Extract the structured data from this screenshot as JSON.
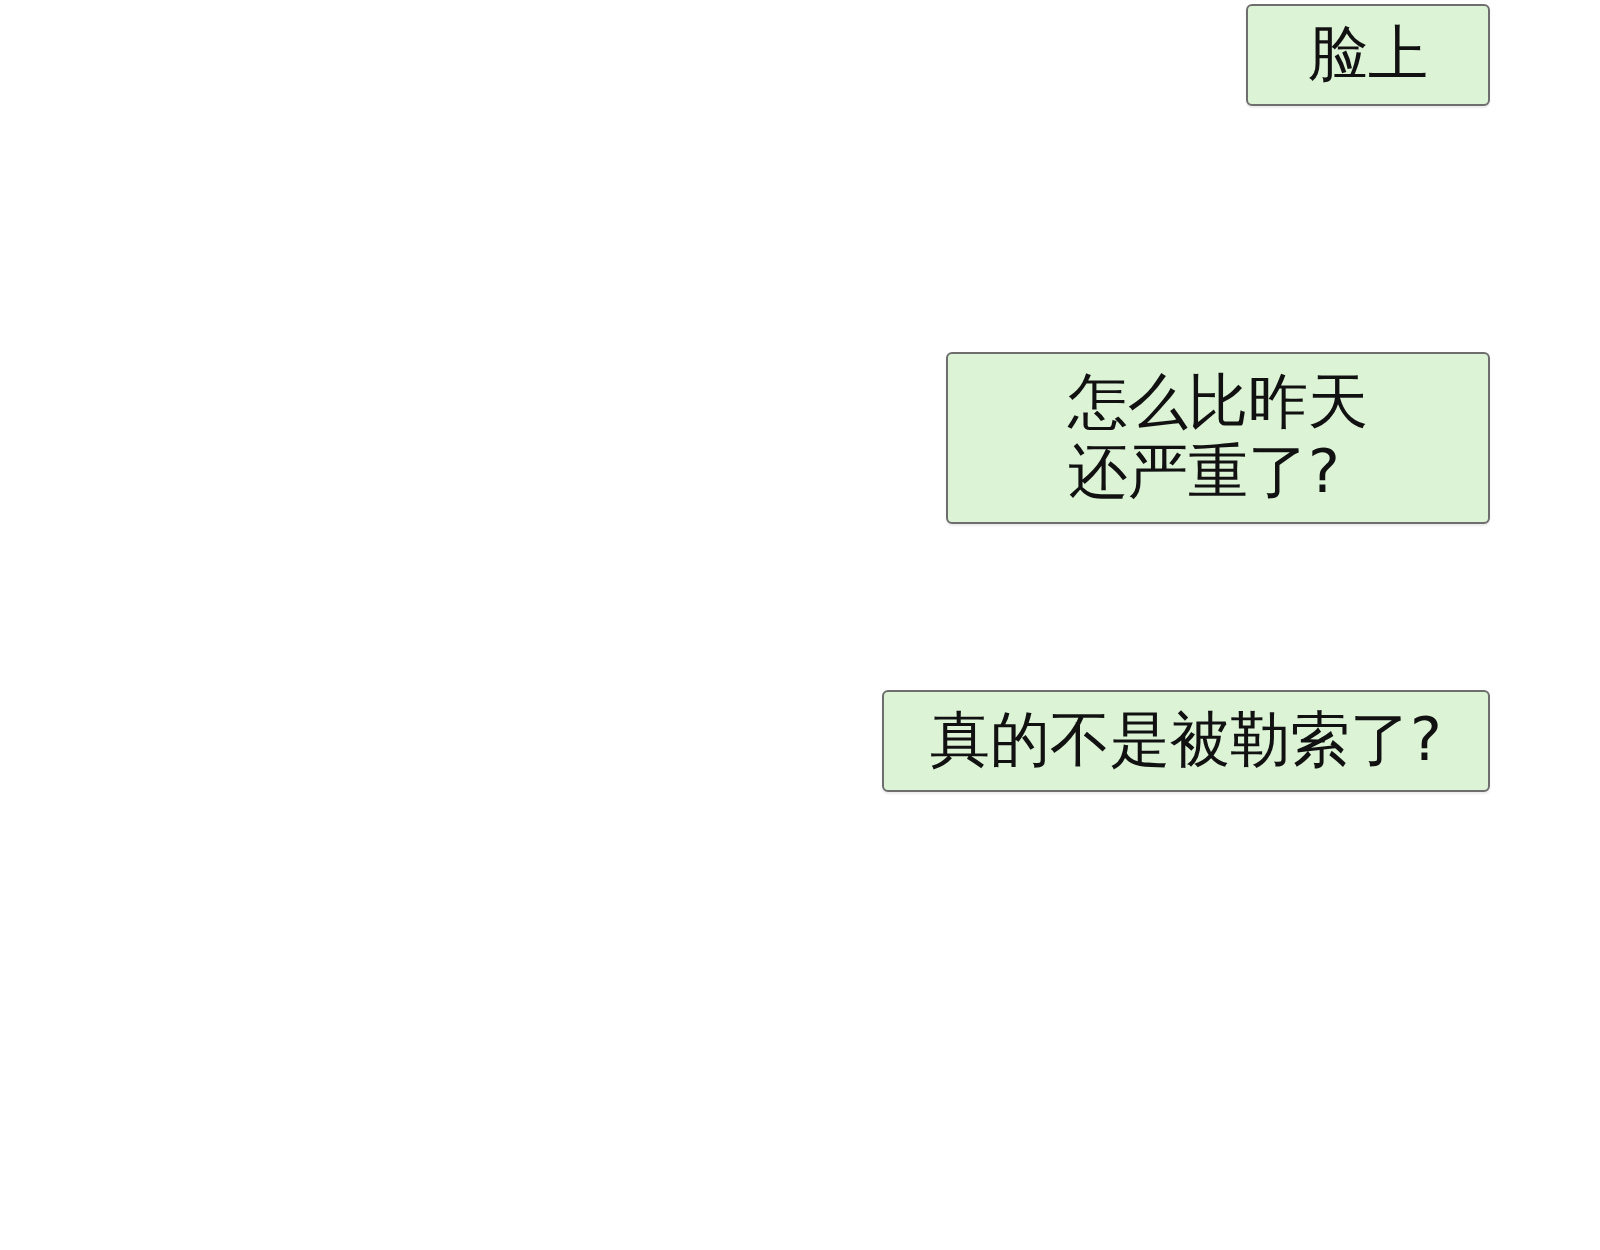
{
  "messages": [
    {
      "lines": [
        "脸上"
      ]
    },
    {
      "lines": [
        "怎么比昨天",
        "还严重了?"
      ]
    },
    {
      "lines": [
        "真的不是被勒索了?"
      ]
    }
  ]
}
